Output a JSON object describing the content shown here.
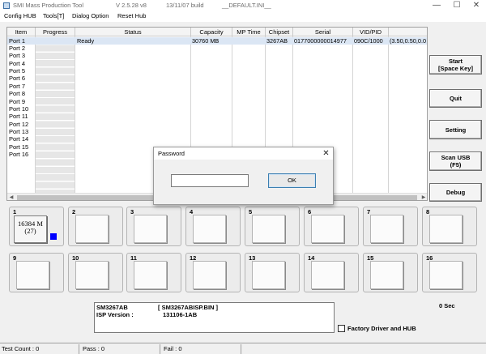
{
  "window": {
    "title": "SMI Mass Production Tool",
    "version": "V 2.5.28  v8",
    "build": "13/11/07 build",
    "config_file": "__DEFAULT.INI__",
    "controls": {
      "minimize": "—",
      "maximize": "☐",
      "close": "✕"
    }
  },
  "menu": [
    "Config HUB",
    "Tools[T]",
    "Dialog Option",
    "Reset Hub"
  ],
  "port_table": {
    "columns": [
      "Item",
      "Progress",
      "Status",
      "Capacity",
      "MP Time",
      "Chipset",
      "Serial",
      "VID/PID",
      ""
    ],
    "ports": [
      "Port 1",
      "Port 2",
      "Port 3",
      "Port 4",
      "Port 5",
      "Port 6",
      "Port 7",
      "Port 8",
      "Port 9",
      "Port 10",
      "Port 11",
      "Port 12",
      "Port 13",
      "Port 14",
      "Port 15",
      "Port 16"
    ],
    "row1": {
      "status": "Ready",
      "capacity": "30760 MB",
      "mp_time": "",
      "chipset": "3267AB",
      "serial": "0177000000014977",
      "vid_pid": "090C/1000",
      "extra": "(3.50,0.50,0.0"
    },
    "scroll": {
      "left": "◀",
      "right": "▶"
    }
  },
  "buttons": {
    "start": "Start\n[Space Key]",
    "quit": "Quit",
    "setting": "Setting",
    "scan_usb": "Scan USB\n(F5)",
    "debug": "Debug"
  },
  "slots": [
    "1",
    "2",
    "3",
    "4",
    "5",
    "6",
    "7",
    "8",
    "9",
    "10",
    "11",
    "12",
    "13",
    "14",
    "15",
    "16"
  ],
  "slot1_capacity": "16384 M\n(27)",
  "slot1_led_color": "#0000ff",
  "info": {
    "model": "SM3267AB",
    "isp_file": "[ SM3267ABISP.BIN ]",
    "isp_label": "ISP Version :",
    "isp_version": "131106-1AB"
  },
  "timer": "0 Sec",
  "factory_driver": {
    "label": "Factory Driver and HUB",
    "checked": false
  },
  "statusbar": {
    "test_count": "Test Count : 0",
    "pass": "Pass : 0",
    "fail": "Fail : 0"
  },
  "password_dialog": {
    "title": "Password",
    "close": "✕",
    "input_value": "",
    "ok": "OK"
  }
}
